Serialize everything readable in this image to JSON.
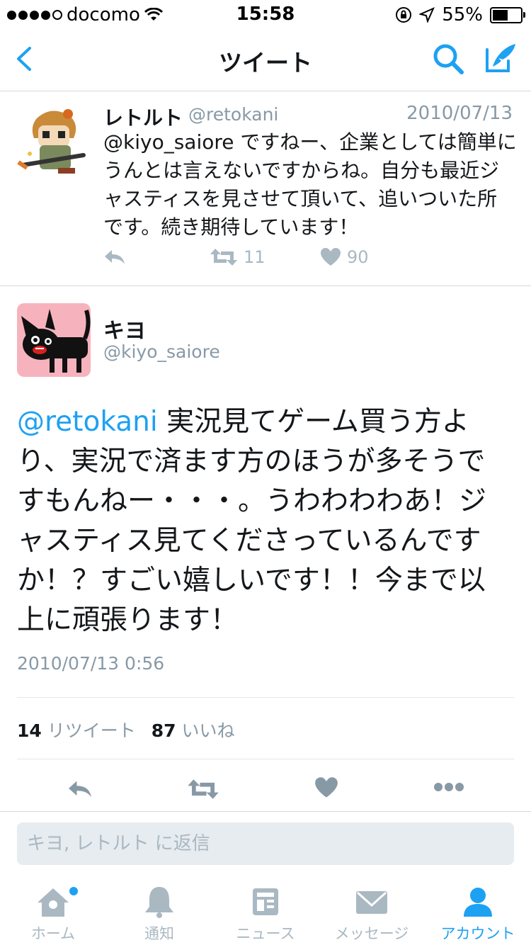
{
  "status_bar": {
    "carrier": "docomo",
    "time": "15:58",
    "battery": "55%",
    "battery_level": 0.55
  },
  "nav": {
    "title": "ツイート"
  },
  "tweet_reply": {
    "name": "レトルト",
    "handle": "@retokani",
    "date": "2010/07/13",
    "text": "@kiyo_saiore ですねー、企業としては簡単にうんとは言えないですからね。自分も最近ジャスティスを見させて頂いて、追いついた所です。続き期待しています！",
    "retweets": "11",
    "likes": "90"
  },
  "tweet_main": {
    "name": "キヨ",
    "handle": "@kiyo_saiore",
    "mention": "@retokani",
    "text": " 実況見てゲーム買う方より、実況で済ます方のほうが多そうですもんねー・・・。うわわわわあ！ジャスティス見てくださっているんですか！？すごい嬉しいです！！今まで以上に頑張ります！",
    "datetime": "2010/07/13 0:56",
    "retweet_count": "14",
    "retweet_label": "リツイート",
    "like_count": "87",
    "like_label": "いいね"
  },
  "reply": {
    "placeholder": "キヨ, レトルト に返信"
  },
  "tabs": [
    {
      "label": "ホーム",
      "icon": "home-icon"
    },
    {
      "label": "通知",
      "icon": "bell-icon"
    },
    {
      "label": "ニュース",
      "icon": "news-icon"
    },
    {
      "label": "メッセージ",
      "icon": "envelope-icon"
    },
    {
      "label": "アカウント",
      "icon": "account-icon"
    }
  ],
  "colors": {
    "accent": "#1da1f2",
    "muted": "#8899a6",
    "icon": "#aab8c2"
  }
}
